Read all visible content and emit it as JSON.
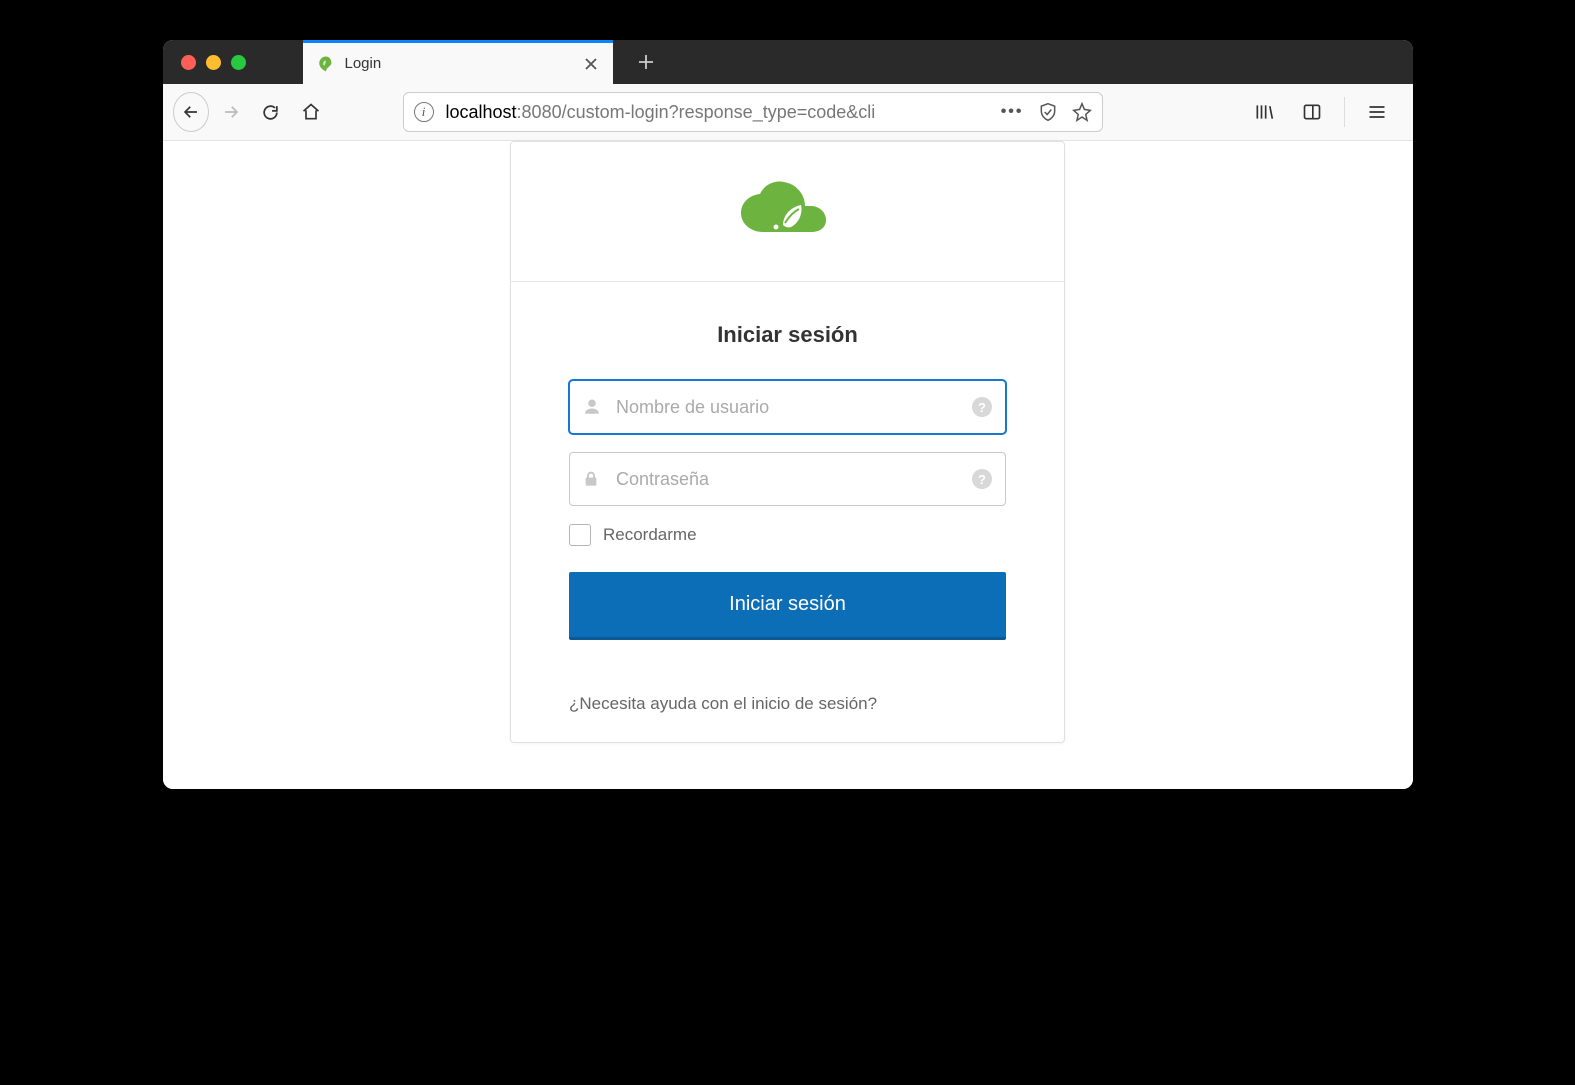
{
  "browser": {
    "tab_title": "Login",
    "url_host": "localhost",
    "url_rest": ":8080/custom-login?response_type=code&cli"
  },
  "login": {
    "title": "Iniciar sesión",
    "username_placeholder": "Nombre de usuario",
    "password_placeholder": "Contraseña",
    "remember_label": "Recordarme",
    "submit_label": "Iniciar sesión",
    "help_text": "¿Necesita ayuda con el inicio de sesión?"
  }
}
